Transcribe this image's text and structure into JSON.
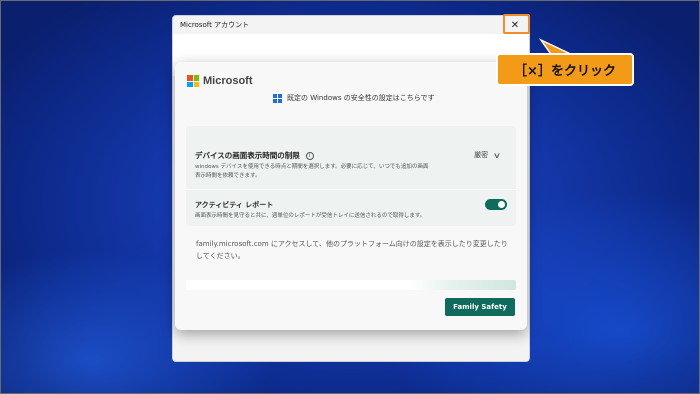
{
  "window": {
    "title": "Microsoft アカウント",
    "close_glyph": "✕"
  },
  "dialog": {
    "brand": "Microsoft",
    "brand_colors": [
      "#f25022",
      "#7fba00",
      "#00a4ef",
      "#ffb900"
    ],
    "default_settings_text": "既定の Windows の安全性の設定はこちらです",
    "screen_time": {
      "title": "デバイスの画面表示時間の制限",
      "info_icon": "i",
      "description": "windows デバイスを使用できる時点と期間を選択します。必要に応じて、いつでも追加の画面表示時間を依頼できます。",
      "value": "厳密",
      "chevron": "∨"
    },
    "activity_report": {
      "title": "アクティビティ レポート",
      "description": "画面表示時間を見守ると共に、週単位のレポートが受信トレイに送信されるので取得します。",
      "enabled": true
    },
    "family_text": "family.microsoft.com にアクセスして、他のプラットフォーム向けの設定を表示したり変更したりしてください。",
    "family_safety_button": "Family Safety"
  },
  "annotation": {
    "callout_text": "［×］をクリック",
    "accent_color": "#f39a16"
  }
}
